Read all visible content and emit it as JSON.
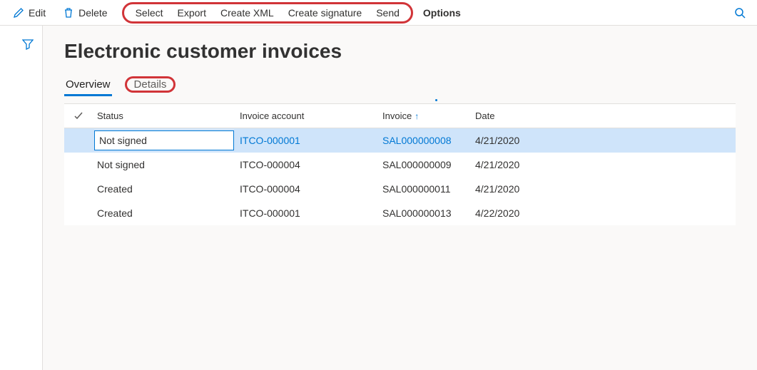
{
  "toolbar": {
    "edit": "Edit",
    "delete": "Delete",
    "select": "Select",
    "export": "Export",
    "create_xml": "Create XML",
    "create_signature": "Create signature",
    "send": "Send",
    "options": "Options"
  },
  "page": {
    "title": "Electronic customer invoices"
  },
  "tabs": {
    "overview": "Overview",
    "details": "Details"
  },
  "grid": {
    "headers": {
      "status": "Status",
      "invoice_account": "Invoice account",
      "invoice": "Invoice",
      "date": "Date"
    },
    "rows": [
      {
        "status": "Not signed",
        "invoice_account": "ITCO-000001",
        "invoice": "SAL000000008",
        "date": "4/21/2020",
        "selected": true,
        "link": true
      },
      {
        "status": "Not signed",
        "invoice_account": "ITCO-000004",
        "invoice": "SAL000000009",
        "date": "4/21/2020",
        "selected": false,
        "link": false
      },
      {
        "status": "Created",
        "invoice_account": "ITCO-000004",
        "invoice": "SAL000000011",
        "date": "4/21/2020",
        "selected": false,
        "link": false
      },
      {
        "status": "Created",
        "invoice_account": "ITCO-000001",
        "invoice": "SAL000000013",
        "date": "4/22/2020",
        "selected": false,
        "link": false
      }
    ]
  }
}
